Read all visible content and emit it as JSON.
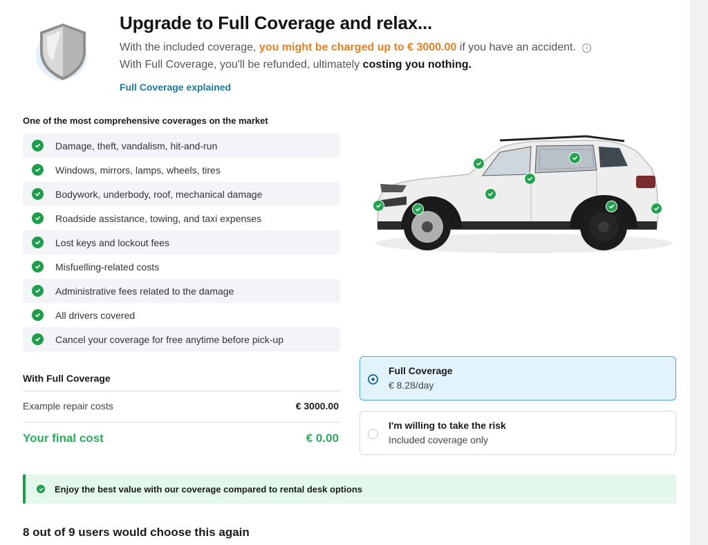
{
  "header": {
    "title": "Upgrade to Full Coverage and relax...",
    "line1_pre": "With the included coverage,",
    "line1_highlight": "you might be charged up to € 3000.00",
    "line1_post": "if you have an accident.",
    "line2_pre": "With Full Coverage, you'll be refunded, ultimately",
    "line2_bold": "costing you nothing.",
    "info_glyph": "i",
    "link": "Full Coverage explained",
    "icon": "shield-icon"
  },
  "features": {
    "heading": "One of the most comprehensive coverages on the market",
    "items": [
      "Damage, theft, vandalism, hit-and-run",
      "Windows, mirrors, lamps, wheels, tires",
      "Bodywork, underbody, roof, mechanical damage",
      "Roadside assistance, towing, and taxi expenses",
      "Lost keys and lockout fees",
      "Misfuelling-related costs",
      "Administrative fees related to the damage",
      "All drivers covered",
      "Cancel your coverage for free anytime before pick-up"
    ]
  },
  "summary": {
    "heading": "With Full Coverage",
    "repair_label": "Example repair costs",
    "repair_value": "€ 3000.00",
    "final_label": "Your final cost",
    "final_value": "€ 0.00"
  },
  "options": [
    {
      "title": "Full Coverage",
      "subtitle": "€ 8.28/day",
      "selected": true
    },
    {
      "title": "I'm willing to take the risk",
      "subtitle": "Included coverage only",
      "selected": false
    }
  ],
  "banner": {
    "text": "Enjoy the best value with our coverage compared to rental desk options"
  },
  "social_proof": {
    "text": "8 out of 9 users would choose this again"
  },
  "colors": {
    "accent_orange": "#e67e22",
    "success_green": "#1e9e4a",
    "final_cost_green": "#2faa5d",
    "link_teal": "#1a7a9a",
    "selected_border": "#4aa6d4",
    "selected_bg": "#e2f3fc"
  }
}
